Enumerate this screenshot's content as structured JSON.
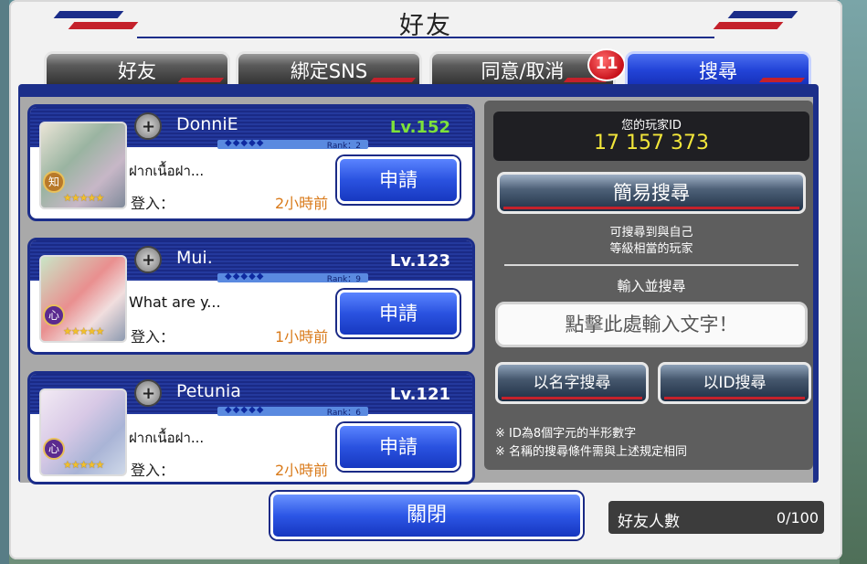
{
  "window": {
    "title": "好友"
  },
  "tabs": [
    {
      "label": "好友",
      "active": false
    },
    {
      "label": "綁定SNS",
      "active": false
    },
    {
      "label": "同意/取消",
      "active": false,
      "badge": "11"
    },
    {
      "label": "搜尋",
      "active": true
    }
  ],
  "cards": [
    {
      "name": "DonniE",
      "level": "Lv.152",
      "rank": "Rank：2",
      "message": "ฝากเนื้อฝา...",
      "login_label": "登入：",
      "login_ago": "2小時前",
      "apply": "申請",
      "attribute": "知",
      "stars": "★★★★★"
    },
    {
      "name": "Mui.",
      "level": "Lv.123",
      "rank": "Rank：9",
      "message": "What are y...",
      "login_label": "登入：",
      "login_ago": "1小時前",
      "apply": "申請",
      "attribute": "心",
      "stars": "★★★★★"
    },
    {
      "name": "Petunia",
      "level": "Lv.121",
      "rank": "Rank：6",
      "message": "ฝากเนื้อฝา...",
      "login_label": "登入：",
      "login_ago": "2小時前",
      "apply": "申請",
      "attribute": "心",
      "stars": "★★★★★"
    }
  ],
  "search_panel": {
    "player_id_label": "您的玩家ID",
    "player_id": "17 157 373",
    "easy_search": "簡易搜尋",
    "easy_hint_1": "可搜尋到與自己",
    "easy_hint_2": "等級相當的玩家",
    "input_section_title": "輸入並搜尋",
    "input_placeholder": "點擊此處輸入文字！",
    "search_by_name": "以名字搜尋",
    "search_by_id": "以ID搜尋",
    "note_1": "※ ID為8個字元的半形數字",
    "note_2": "※ 名稱的搜尋條件需與上述規定相同"
  },
  "footer": {
    "close": "關閉",
    "friend_count_label": "好友人數",
    "friend_count_value": "0/100"
  },
  "colors": {
    "accent_blue": "#2a52e0",
    "accent_red": "#c4212b",
    "level_highlight": "#7de23a",
    "login_orange": "#d97a1a",
    "player_id_yellow": "#f2e63a"
  },
  "icons": [
    "cross-emblem-icon",
    "star-icon"
  ]
}
